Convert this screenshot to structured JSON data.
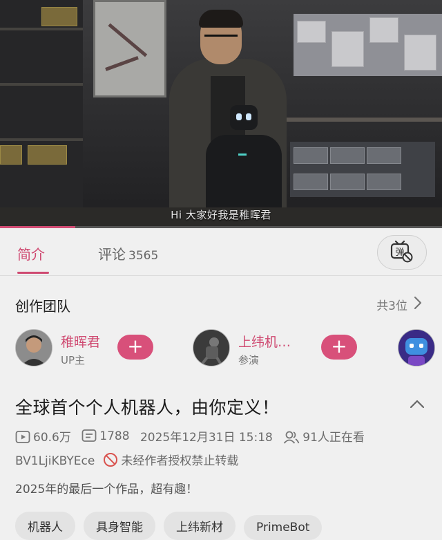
{
  "video": {
    "subtitle": "Hi 大家好我是稚晖君",
    "progress": 0.17
  },
  "tabs": [
    {
      "label": "简介",
      "count": ""
    },
    {
      "label": "评论",
      "count": "3565"
    }
  ],
  "danmaku_button": {
    "icon": "danmaku-off-icon",
    "glyph": "弹"
  },
  "creators_section": {
    "title": "创作团队",
    "count_label": "共3位"
  },
  "creators": [
    {
      "name": "稚晖君",
      "role": "UP主",
      "follow_label": "+"
    },
    {
      "name": "上纬机…",
      "role": "参演",
      "follow_label": "+"
    }
  ],
  "video_info": {
    "title": "全球首个个人机器人，由你定义！",
    "views": "60.6万",
    "danmaku_count": "1788",
    "publish_time": "2025年12月31日 15:18",
    "watching": "91人正在看",
    "bvid": "BV1LjiKBYEce",
    "copyright": "未经作者授权禁止转载",
    "description": "2025年的最后一个作品，超有趣！"
  },
  "tags": [
    "机器人",
    "具身智能",
    "上纬新材",
    "PrimeBot"
  ],
  "colors": {
    "accent": "#cf4a71",
    "follow_bg": "#d8507a"
  }
}
